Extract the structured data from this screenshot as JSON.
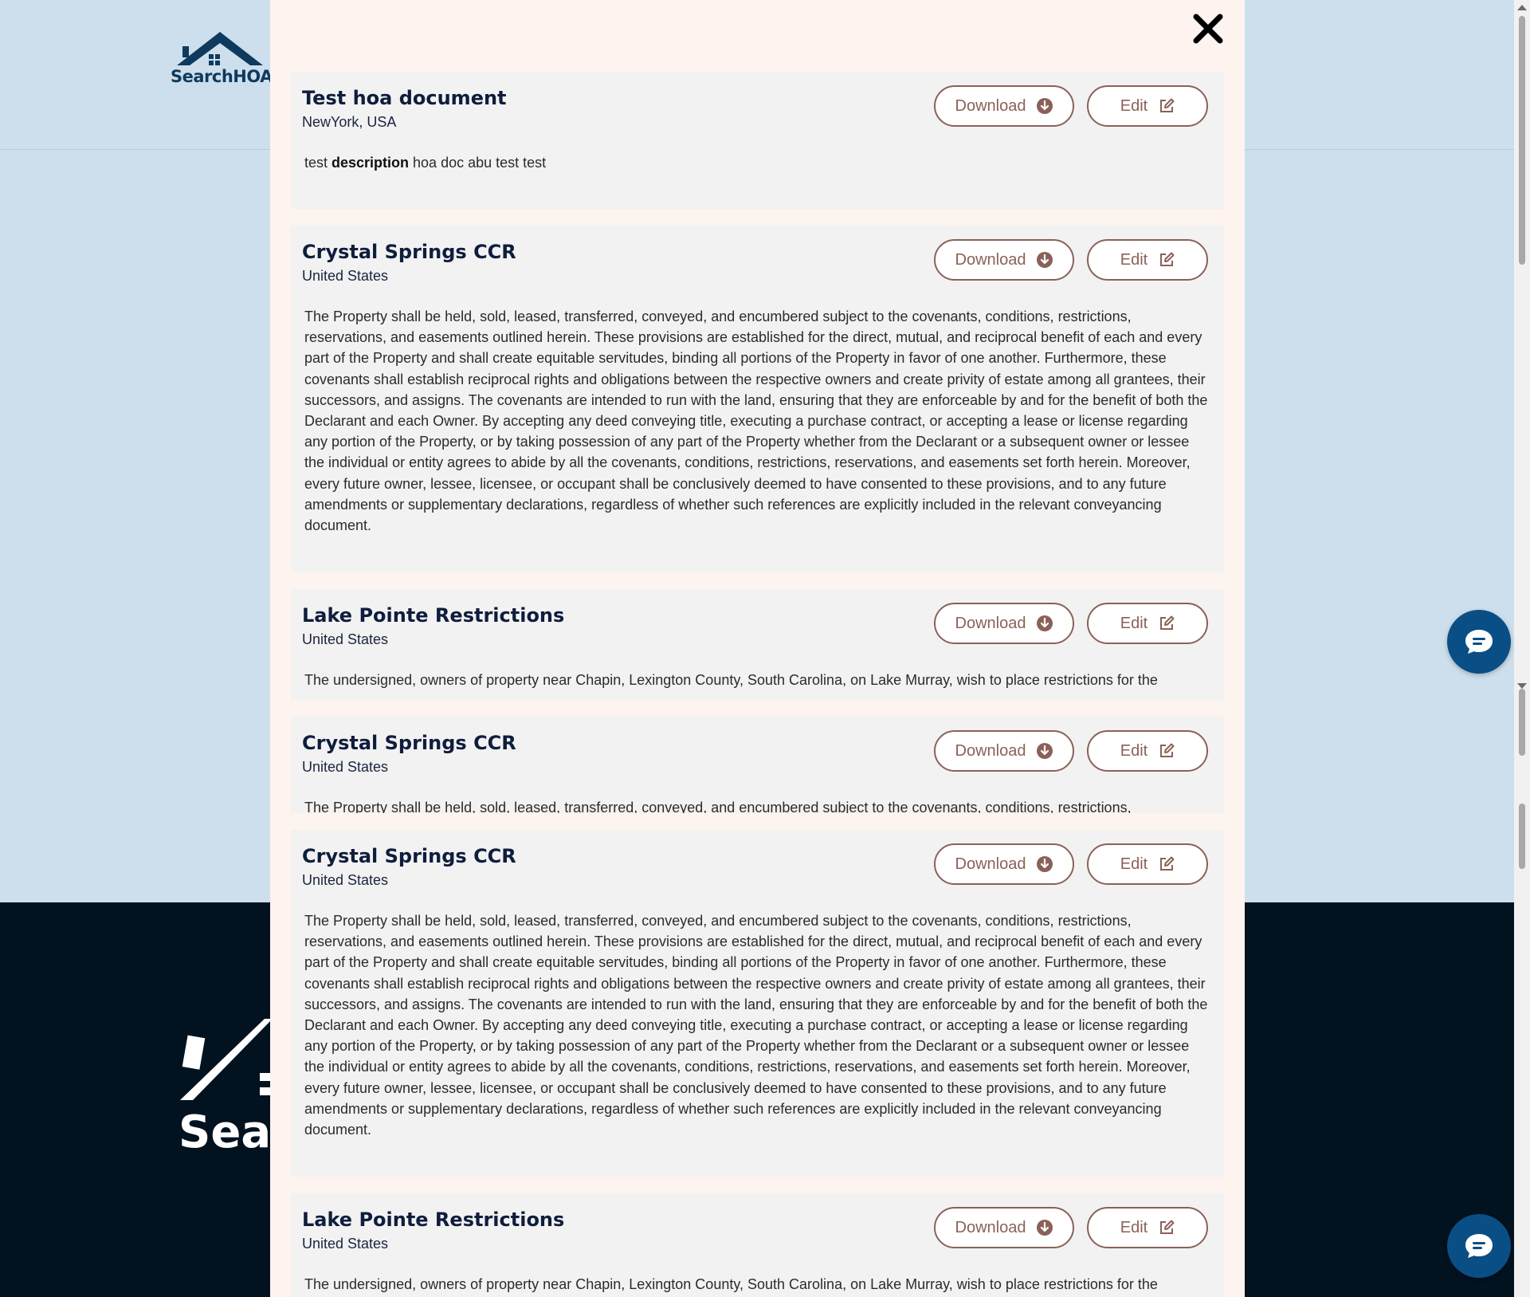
{
  "brand": {
    "name": "SearchHOA",
    "footer_name": "Sear"
  },
  "modal": {
    "close_icon": "close-x-icon",
    "documents": [
      {
        "title": "Test hoa document",
        "location": "NewYork, USA",
        "description_pre": "test ",
        "description_bold": "description",
        "description_post": " hoa doc abu test test",
        "download_label": "Download",
        "edit_label": "Edit"
      },
      {
        "title": "Crystal Springs CCR",
        "location": "United States",
        "description": "The Property shall be held, sold, leased, transferred, conveyed, and encumbered subject to the covenants, conditions, restrictions, reservations, and easements outlined herein. These provisions are established for the direct, mutual, and reciprocal benefit of each and every part of the Property and shall create equitable servitudes, binding all portions of the Property in favor of one another. Furthermore, these covenants shall establish reciprocal rights and obligations between the respective owners and create privity of estate among all grantees, their successors, and assigns. The covenants are intended to run with the land, ensuring that they are enforceable by and for the benefit of both the Declarant and each Owner. By accepting any deed conveying title, executing a purchase contract, or accepting a lease or license regarding any portion of the Property, or by taking possession of any part of the Property whether from the Declarant or a subsequent owner or lessee the individual or entity agrees to abide by all the covenants, conditions, restrictions, reservations, and easements set forth herein. Moreover, every future owner, lessee, licensee, or occupant shall be conclusively deemed to have consented to these provisions, and to any future amendments or supplementary declarations, regardless of whether such references are explicitly included in the relevant conveyancing document.",
        "download_label": "Download",
        "edit_label": "Edit"
      },
      {
        "title": "Lake Pointe Restrictions",
        "location": "United States",
        "description": "The undersigned, owners of property near Chapin, Lexington County, South Carolina, on Lake Murray, wish to place restrictions for the",
        "download_label": "Download",
        "edit_label": "Edit"
      },
      {
        "title": "Crystal Springs CCR",
        "location": "United States",
        "description": "The Property shall be held, sold, leased, transferred, conveyed, and encumbered subject to the covenants, conditions, restrictions,",
        "download_label": "Download",
        "edit_label": "Edit"
      },
      {
        "title": "Crystal Springs CCR",
        "location": "United States",
        "description": "The Property shall be held, sold, leased, transferred, conveyed, and encumbered subject to the covenants, conditions, restrictions, reservations, and easements outlined herein. These provisions are established for the direct, mutual, and reciprocal benefit of each and every part of the Property and shall create equitable servitudes, binding all portions of the Property in favor of one another. Furthermore, these covenants shall establish reciprocal rights and obligations between the respective owners and create privity of estate among all grantees, their successors, and assigns. The covenants are intended to run with the land, ensuring that they are enforceable by and for the benefit of both the Declarant and each Owner. By accepting any deed conveying title, executing a purchase contract, or accepting a lease or license regarding any portion of the Property, or by taking possession of any part of the Property whether from the Declarant or a subsequent owner or lessee the individual or entity agrees to abide by all the covenants, conditions, restrictions, reservations, and easements set forth herein. Moreover, every future owner, lessee, licensee, or occupant shall be conclusively deemed to have consented to these provisions, and to any future amendments or supplementary declarations, regardless of whether such references are explicitly included in the relevant conveyancing document.",
        "download_label": "Download",
        "edit_label": "Edit"
      },
      {
        "title": "Lake Pointe Restrictions",
        "location": "United States",
        "description": "The undersigned, owners of property near Chapin, Lexington County, South Carolina, on Lake Murray, wish to place restrictions for the",
        "download_label": "Download",
        "edit_label": "Edit"
      }
    ]
  },
  "colors": {
    "modal_bg": "#fdf3ef",
    "card_bg": "#f2f2f2",
    "button_border": "#8a6158",
    "title": "#0f1d3d",
    "chat_button": "#0a4e86",
    "footer_bg": "#02121f",
    "page_bg": "#cddfec"
  }
}
